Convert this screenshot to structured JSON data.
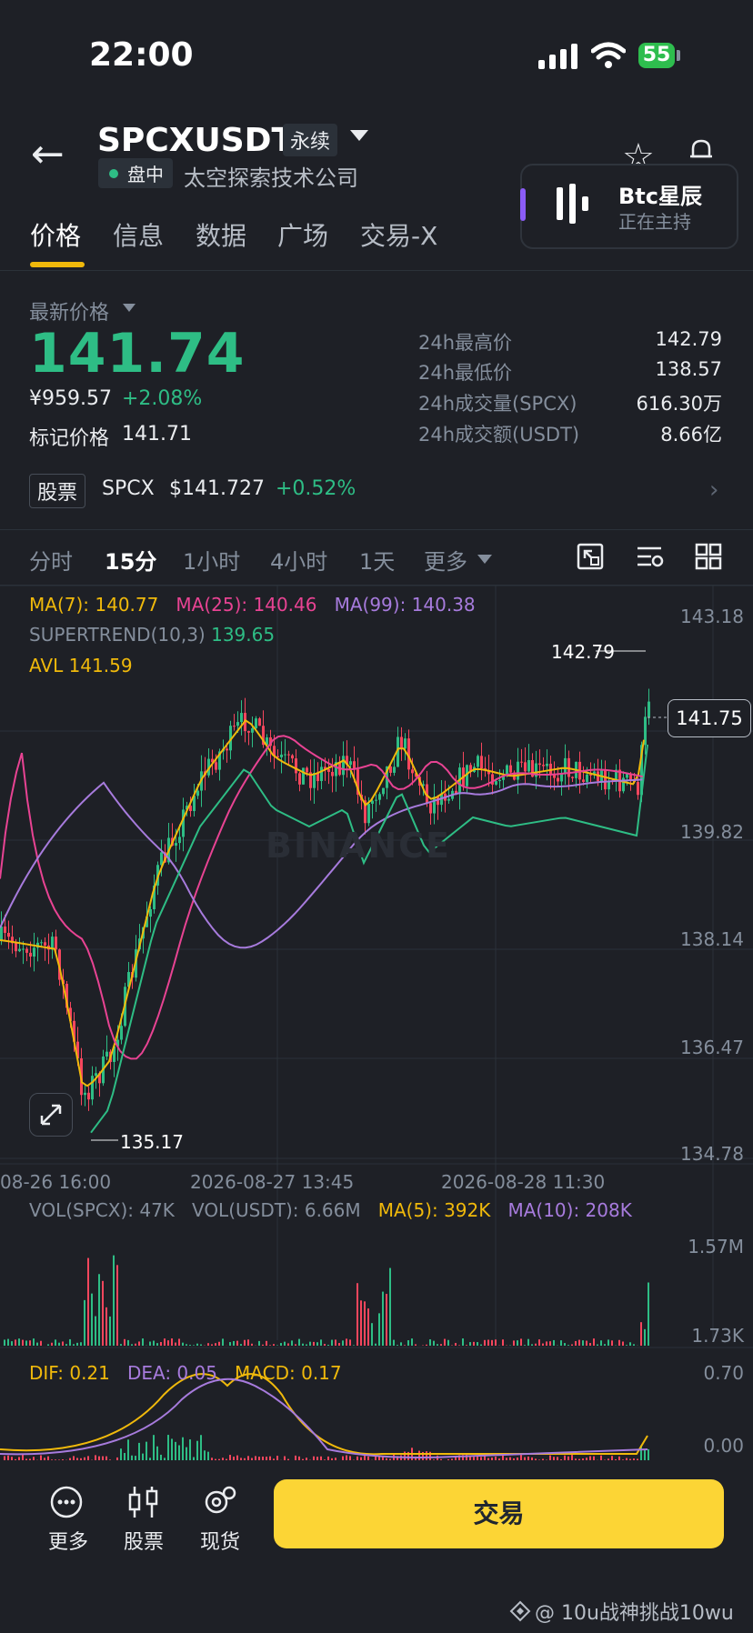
{
  "status_bar": {
    "time": "22:00",
    "battery": "55"
  },
  "header": {
    "symbol": "SPCXUSDT",
    "contract_type": "永续",
    "session": "盘中",
    "company": "太空探索技术公司"
  },
  "live": {
    "title": "Btc星辰",
    "subtitle": "正在主持"
  },
  "tabs": [
    {
      "label": "价格",
      "active": true
    },
    {
      "label": "信息"
    },
    {
      "label": "数据"
    },
    {
      "label": "广场"
    },
    {
      "label": "交易-X"
    }
  ],
  "price": {
    "latest_label": "最新价格",
    "last": "141.74",
    "cny": "¥959.57",
    "change_pct": "+2.08%",
    "mark_label": "标记价格",
    "mark": "141.71"
  },
  "stats": [
    {
      "label": "24h最高价",
      "value": "142.79"
    },
    {
      "label": "24h最低价",
      "value": "138.57"
    },
    {
      "label": "24h成交量(SPCX)",
      "value": "616.30万"
    },
    {
      "label": "24h成交额(USDT)",
      "value": "8.66亿"
    }
  ],
  "stock": {
    "badge": "股票",
    "symbol": "SPCX",
    "price": "$141.727",
    "change": "+0.52%"
  },
  "intervals": [
    {
      "label": "分时"
    },
    {
      "label": "15分",
      "active": true
    },
    {
      "label": "1小时"
    },
    {
      "label": "4小时"
    },
    {
      "label": "1天"
    },
    {
      "label": "更多"
    }
  ],
  "indicators": {
    "ma7": "MA(7): 140.77",
    "ma25": "MA(25): 140.46",
    "ma99": "MA(99): 140.38",
    "supertrend_label": "SUPERTREND(10,3)",
    "supertrend_value": "139.65",
    "avl": "AVL 141.59",
    "vol_spcx": "VOL(SPCX): 47K",
    "vol_usdt": "VOL(USDT): 6.66M",
    "vol_ma5": "MA(5): 392K",
    "vol_ma10": "MA(10): 208K",
    "dif": "DIF: 0.21",
    "dea": "DEA: 0.05",
    "macd": "MACD: 0.17"
  },
  "chart": {
    "price_axis": [
      "143.18",
      "139.82",
      "138.14",
      "136.47",
      "134.78"
    ],
    "last_price_tag": "141.75",
    "high_marker": "142.79",
    "low_marker": "135.17",
    "dates": [
      "08-26 16:00",
      "2026-08-27 13:45",
      "2026-08-28 11:30"
    ],
    "vol_axis": [
      "1.57M",
      "1.73K"
    ],
    "macd_axis": [
      "0.70",
      "0.00"
    ],
    "colors": {
      "up": "#2ebd85",
      "down": "#f6465d",
      "ma7": "#f0b90b",
      "ma25": "#e84393",
      "ma99": "#a77bdd"
    }
  },
  "bottom_nav": [
    {
      "label": "更多",
      "icon": "more-icon"
    },
    {
      "label": "股票",
      "icon": "stock-icon"
    },
    {
      "label": "现货",
      "icon": "spot-icon"
    }
  ],
  "trade_button": "交易",
  "watermark": "@ 10u战神挑战10wu"
}
